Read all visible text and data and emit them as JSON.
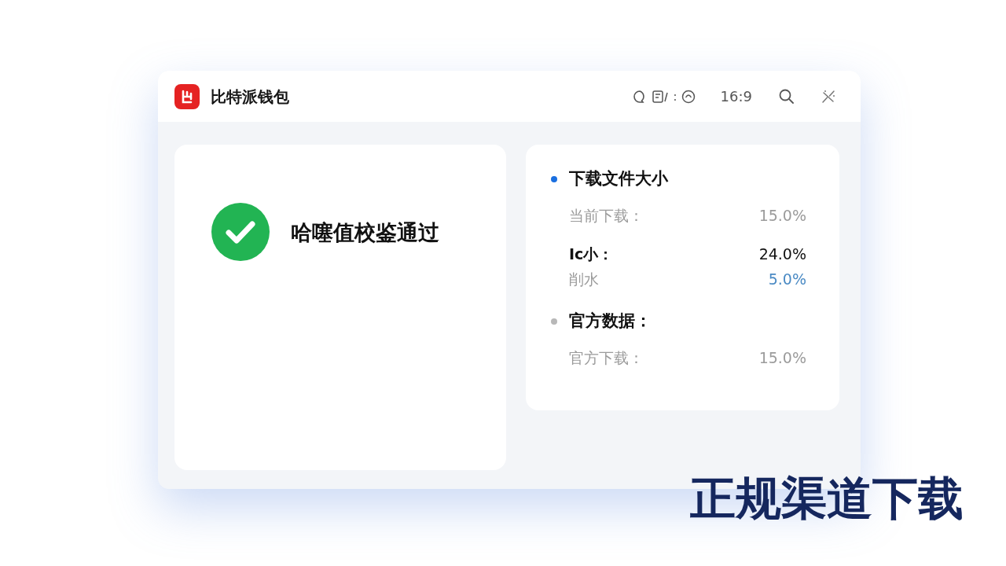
{
  "window": {
    "title": "比特派钱包",
    "toolbar": {
      "separator": ":",
      "ratio": "16:9"
    }
  },
  "status_card": {
    "message": "哈噻值校鉴通过",
    "verified": true
  },
  "details": {
    "sections": [
      {
        "heading": "下载文件大小",
        "color": "#1a6fe0",
        "rows": [
          {
            "label": "当前下载：",
            "value": "15.0%",
            "kind": "muted"
          },
          {
            "label": "Ic小：",
            "value": "24.0%",
            "kind": "strong"
          },
          {
            "label": "削水",
            "value": "5.0%",
            "kind": "highlight"
          }
        ]
      },
      {
        "heading": "官方数据：",
        "color": "#b8b8b8",
        "rows": [
          {
            "label": "官方下载：",
            "value": "15.0%",
            "kind": "muted"
          }
        ]
      }
    ]
  },
  "caption": "正规渠道下载"
}
